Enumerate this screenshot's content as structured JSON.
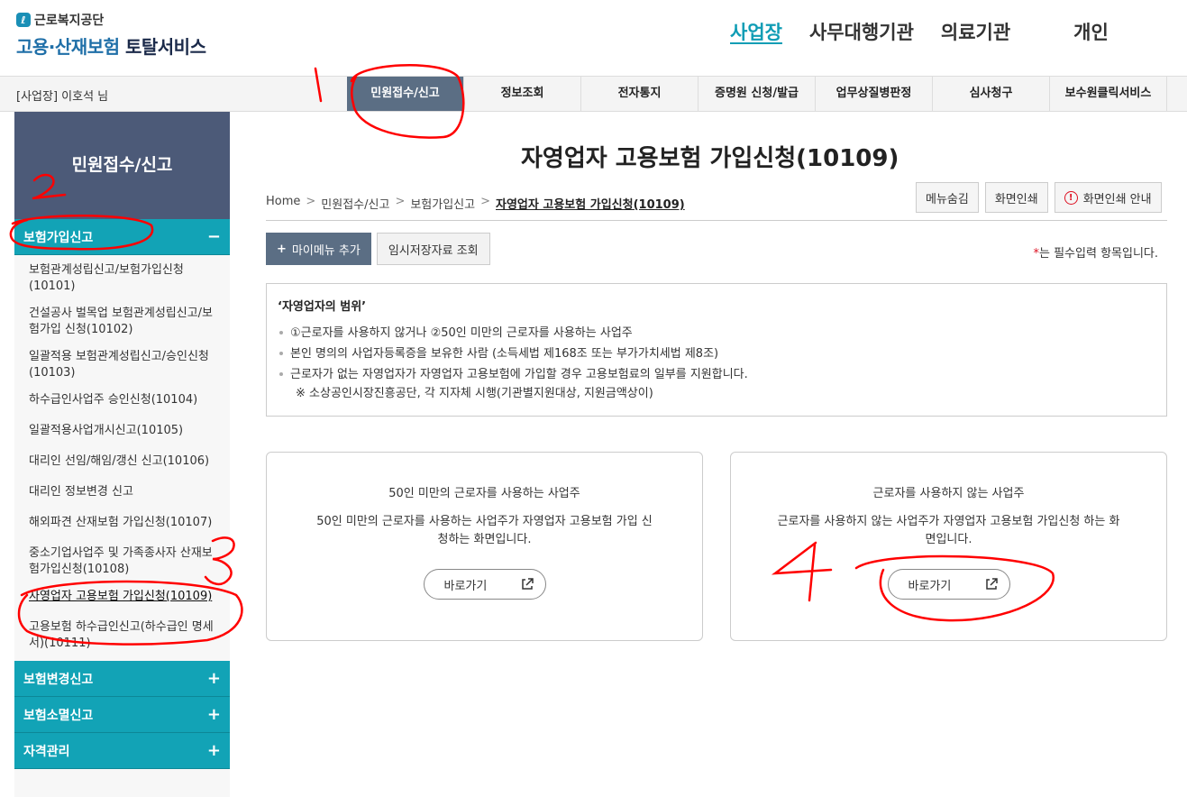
{
  "header": {
    "org": "근로복지공단",
    "service": "고용·산재보험",
    "service_suffix": "토탈서비스",
    "gnb": [
      "사업장",
      "사무대행기관",
      "의료기관",
      "개인"
    ]
  },
  "menubar": {
    "user": "[사업장] 이호석 님",
    "tabs": [
      "민원접수/신고",
      "정보조회",
      "전자통지",
      "증명원 신청/발급",
      "업무상질병판정",
      "심사청구",
      "보수원클릭서비스"
    ]
  },
  "sidebar": {
    "title": "민원접수/신고",
    "open_section": "보험가입신고",
    "items": [
      "보험관계성립신고/보험가입신청(10101)",
      "건설공사 벌목업 보험관계성립신고/보험가입 신청(10102)",
      "일괄적용 보험관계성립신고/승인신청(10103)",
      "하수급인사업주 승인신청(10104)",
      "일괄적용사업개시신고(10105)",
      "대리인 선임/해임/갱신 신고(10106)",
      "대리인 정보변경 신고",
      "해외파견 산재보험 가입신청(10107)",
      "중소기업사업주 및 가족종사자 산재보험가입신청(10108)",
      "자영업자 고용보험 가입신청(10109)",
      "고용보험 하수급인신고(하수급인 명세서)(10111)"
    ],
    "collapsed_sections": [
      "보험변경신고",
      "보험소멸신고",
      "자격관리"
    ],
    "minus": "−",
    "plus": "+"
  },
  "main": {
    "title": "자영업자 고용보험 가입신청(10109)",
    "breadcrumb": [
      "Home",
      "민원접수/신고",
      "보험가입신고",
      "자영업자 고용보험 가입신청(10109)"
    ],
    "util_buttons": [
      "메뉴숨김",
      "화면인쇄",
      "화면인쇄 안내"
    ],
    "add_menu": "마이메뉴 추가",
    "temp_load": "임시저장자료 조회",
    "required_star": "*",
    "required_text": "는 필수입력 항목입니다.",
    "info": {
      "title": "‘자영업자의 범위’",
      "lines": [
        "①근로자를 사용하지 않거나 ②50인 미만의 근로자를 사용하는 사업주",
        "본인 명의의 사업자등록증을 보유한 사람 (소득세법 제168조 또는 부가가치세법 제8조)",
        "근로자가 없는 자영업자가 자영업자 고용보험에 가입할 경우 고용보험료의 일부를 지원합니다."
      ],
      "note": "※ 소상공인시장진흥공단, 각 지자체 시행(기관별지원대상, 지원금액상이)"
    },
    "cards": [
      {
        "title": "50인 미만의 근로자를 사용하는 사업주",
        "desc": "50인 미만의 근로자를 사용하는 사업주가 자영업자 고용보험 가입 신청하는 화면입니다.",
        "button": "바로가기"
      },
      {
        "title": "근로자를 사용하지 않는 사업주",
        "desc": "근로자를 사용하지 않는 사업주가 자영업자 고용보험 가입신청 하는 화면입니다.",
        "button": "바로가기"
      }
    ]
  },
  "colors": {
    "accent": "#12a3b6",
    "nav_dark": "#4c5a78",
    "tab_active": "#5b6e84",
    "annotation": "#ff0000"
  },
  "annotations": [
    "1",
    "2",
    "3",
    "4"
  ]
}
